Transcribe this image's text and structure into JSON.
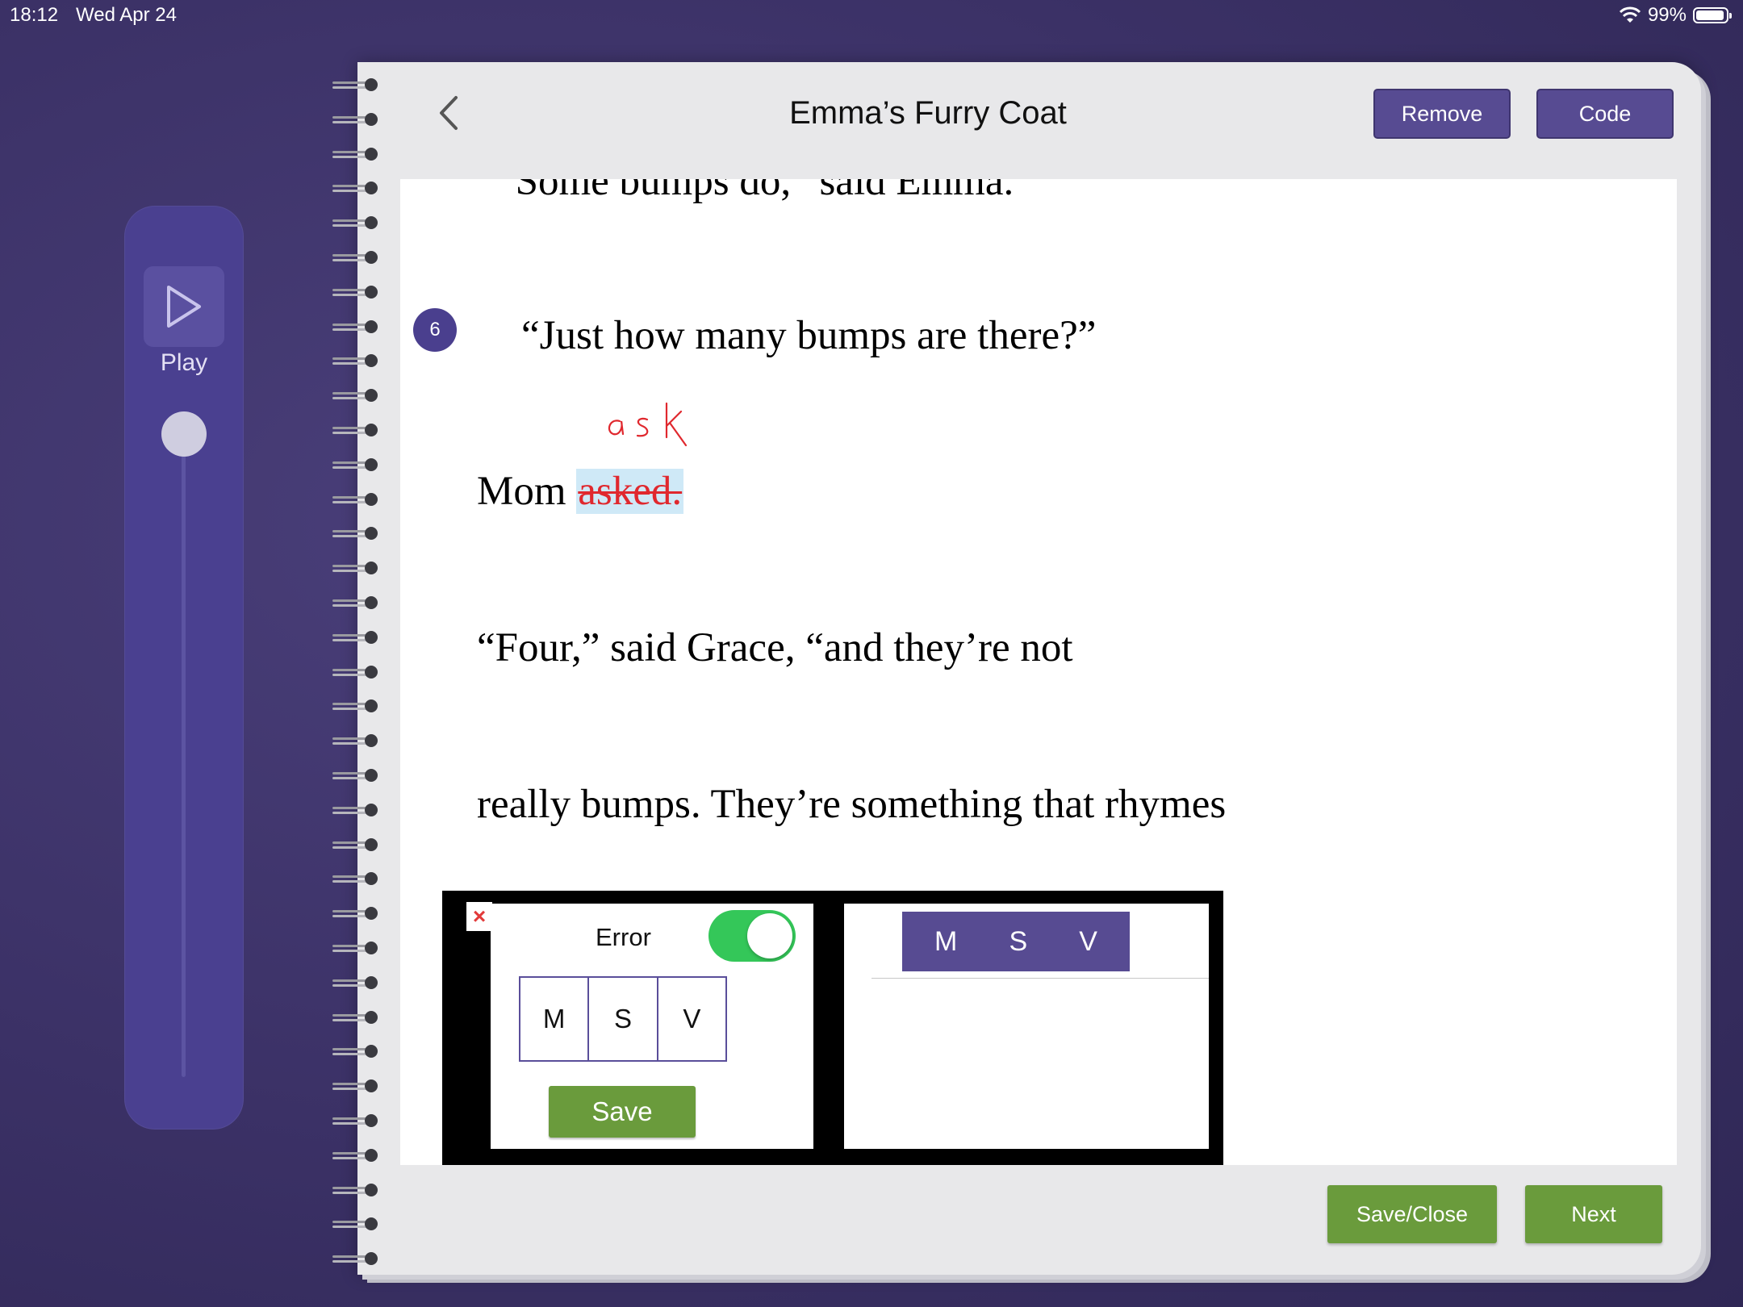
{
  "status_bar": {
    "time": "18:12",
    "date": "Wed Apr 24",
    "battery": "99%"
  },
  "player": {
    "play_label": "Play"
  },
  "header": {
    "title": "Emma’s Furry Coat",
    "remove_label": "Remove",
    "code_label": "Code"
  },
  "story": {
    "cut_line": "“Some bumps do,” said Emma.",
    "line_number": "6",
    "line6": "“Just how many bumps are there?”",
    "mom": "Mom ",
    "error_word": "asked.",
    "handwritten_correction": "ask",
    "four_line": "“Four,” said Grace, “and they’re not",
    "bumps_line": "really bumps. They’re something that rhymes"
  },
  "error_panel": {
    "close": "×",
    "error_label": "Error",
    "error_toggle_on": true,
    "msv": [
      "M",
      "S",
      "V"
    ],
    "save_label": "Save",
    "selected_msv": [
      "M",
      "S",
      "V"
    ]
  },
  "footer": {
    "save_close_label": "Save/Close",
    "next_label": "Next"
  },
  "colors": {
    "accent_purple": "#574b92",
    "green": "#6a9b3c",
    "toggle_green": "#34c759",
    "error_red": "#e0282e",
    "highlight_blue": "#cfe9f7"
  }
}
